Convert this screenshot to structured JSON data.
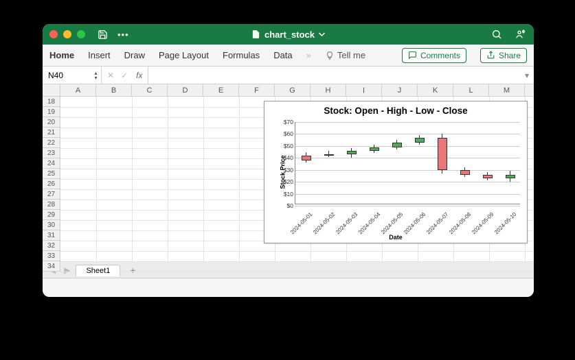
{
  "titlebar": {
    "filename": "chart_stock"
  },
  "ribbon": {
    "tabs": {
      "home": "Home",
      "insert": "Insert",
      "draw": "Draw",
      "page_layout": "Page Layout",
      "formulas": "Formulas",
      "data": "Data"
    },
    "tell_me": "Tell me",
    "comments": "Comments",
    "share": "Share"
  },
  "formula_bar": {
    "name_box": "N40",
    "fx": "fx",
    "value": ""
  },
  "columns": [
    "A",
    "B",
    "C",
    "D",
    "E",
    "F",
    "G",
    "H",
    "I",
    "J",
    "K",
    "L",
    "M"
  ],
  "rows": [
    "18",
    "19",
    "20",
    "21",
    "22",
    "23",
    "24",
    "25",
    "26",
    "27",
    "28",
    "29",
    "30",
    "31",
    "32",
    "33",
    "34"
  ],
  "sheet_tabs": {
    "sheet1": "Sheet1"
  },
  "chart_data": {
    "type": "candlestick",
    "title": "Stock: Open - High - Low - Close",
    "xlabel": "Date",
    "ylabel": "Stock Price",
    "ylim": [
      0,
      70
    ],
    "yticks": [
      "$0",
      "$10",
      "$20",
      "$30",
      "$40",
      "$50",
      "$60",
      "$70"
    ],
    "categories": [
      "2024-05-01",
      "2024-05-02",
      "2024-05-03",
      "2024-05-04",
      "2024-05-05",
      "2024-05-06",
      "2024-05-07",
      "2024-05-08",
      "2024-05-09",
      "2024-05-10"
    ],
    "series": [
      {
        "open": 42,
        "high": 45,
        "low": 36,
        "close": 38
      },
      {
        "open": 42,
        "high": 46,
        "low": 41,
        "close": 43
      },
      {
        "open": 43,
        "high": 48,
        "low": 40,
        "close": 46
      },
      {
        "open": 46,
        "high": 51,
        "low": 44,
        "close": 49
      },
      {
        "open": 49,
        "high": 55,
        "low": 47,
        "close": 53
      },
      {
        "open": 53,
        "high": 59,
        "low": 51,
        "close": 57
      },
      {
        "open": 57,
        "high": 60,
        "low": 27,
        "close": 30
      },
      {
        "open": 30,
        "high": 32,
        "low": 24,
        "close": 26
      },
      {
        "open": 26,
        "high": 28,
        "low": 21,
        "close": 23
      },
      {
        "open": 23,
        "high": 29,
        "low": 20,
        "close": 26
      }
    ]
  }
}
